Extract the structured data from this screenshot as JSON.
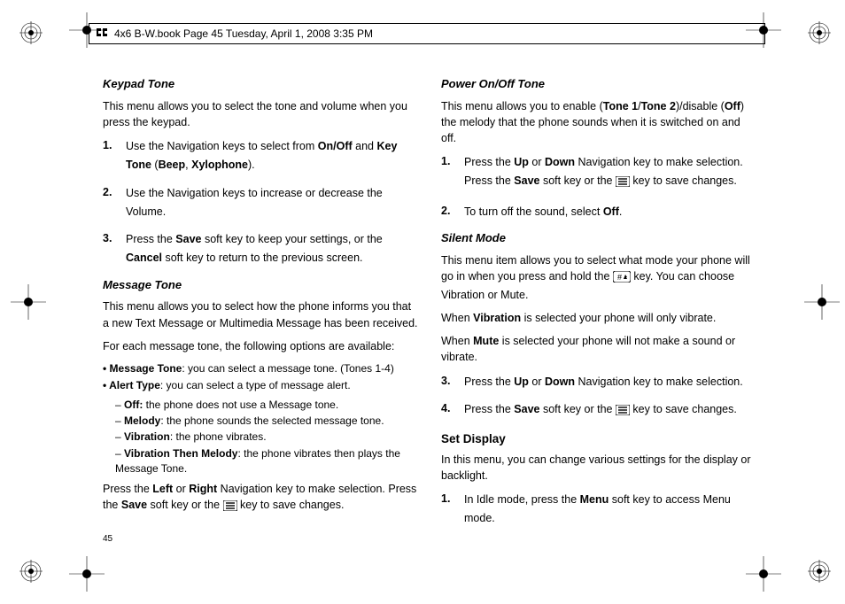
{
  "header": {
    "text": "4x6 B-W.book  Page 45  Tuesday, April 1, 2008  3:35 PM"
  },
  "page_number": "45",
  "left": {
    "keypad": {
      "title": "Keypad Tone",
      "intro": "This menu allows you to select the tone and volume when you press the keypad.",
      "steps": [
        "Use the Navigation keys to select from <b>On/Off</b> and <b>Key Tone</b> (<b>Beep</b>, <b>Xylophone</b>).",
        "Use the Navigation keys to increase or decrease the Volume.",
        "Press the <b>Save</b> soft key to keep your settings, or the <b>Cancel</b> soft key to return to the previous screen."
      ]
    },
    "message": {
      "title": "Message Tone",
      "intro1": "This menu allows you to select how the phone informs you that a new Text Message or Multimedia Message has been received.",
      "intro2": "For each message tone, the following options are available:",
      "bullets": [
        "<b>Message Tone</b>: you can select a message tone. (Tones 1-4)",
        "<b>Alert Type</b>: you can select a type of message alert."
      ],
      "sub": [
        "<b>Off:</b> the phone does not use a Message tone.",
        "<b>Melody</b>: the phone sounds the selected message tone.",
        "<b>Vibration</b>: the phone vibrates.",
        "<b>Vibration Then Melody</b>: the phone vibrates then plays the Message Tone."
      ],
      "outro_pre": "Press the <b>Left</b> or <b>Right</b> Navigation key to make selection. Press the <b>Save</b> soft key or the ",
      "outro_post": " key to save changes."
    }
  },
  "right": {
    "power": {
      "title": "Power On/Off Tone",
      "intro": "This menu allows you to enable (<b>Tone 1</b>/<b>Tone 2</b>)/disable (<b>Off</b>) the melody that the phone sounds when it is switched on and off.",
      "steps": [
        {
          "pre": "Press the <b>Up</b> or <b>Down</b> Navigation key to make selection. Press the <b>Save</b> soft key or the ",
          "post": " key to save changes.",
          "icon": true
        },
        {
          "pre": "To turn off the sound, select <b>Off</b>.",
          "post": "",
          "icon": false
        }
      ]
    },
    "silent": {
      "title": "Silent Mode",
      "intro_pre": "This menu item allows you to select what mode your phone will go in when you press and hold the ",
      "intro_post": " key. You can choose Vibration or Mute.",
      "vib": "When <b>Vibration</b> is selected your phone will only vibrate.",
      "mute": "When <b>Mute</b> is selected your phone will not make a sound or vibrate.",
      "steps": [
        {
          "n": "3.",
          "pre": "Press the <b>Up</b> or <b>Down</b> Navigation key to make selection.",
          "post": "",
          "icon": false
        },
        {
          "n": "4.",
          "pre": "Press the <b>Save</b> soft key or the ",
          "post": " key to save changes.",
          "icon": true
        }
      ]
    },
    "display": {
      "title": "Set Display",
      "intro": "In this menu, you can change various settings for the display or backlight.",
      "steps": [
        "In Idle mode, press the <b>Menu</b> soft key to access Menu mode."
      ]
    }
  }
}
